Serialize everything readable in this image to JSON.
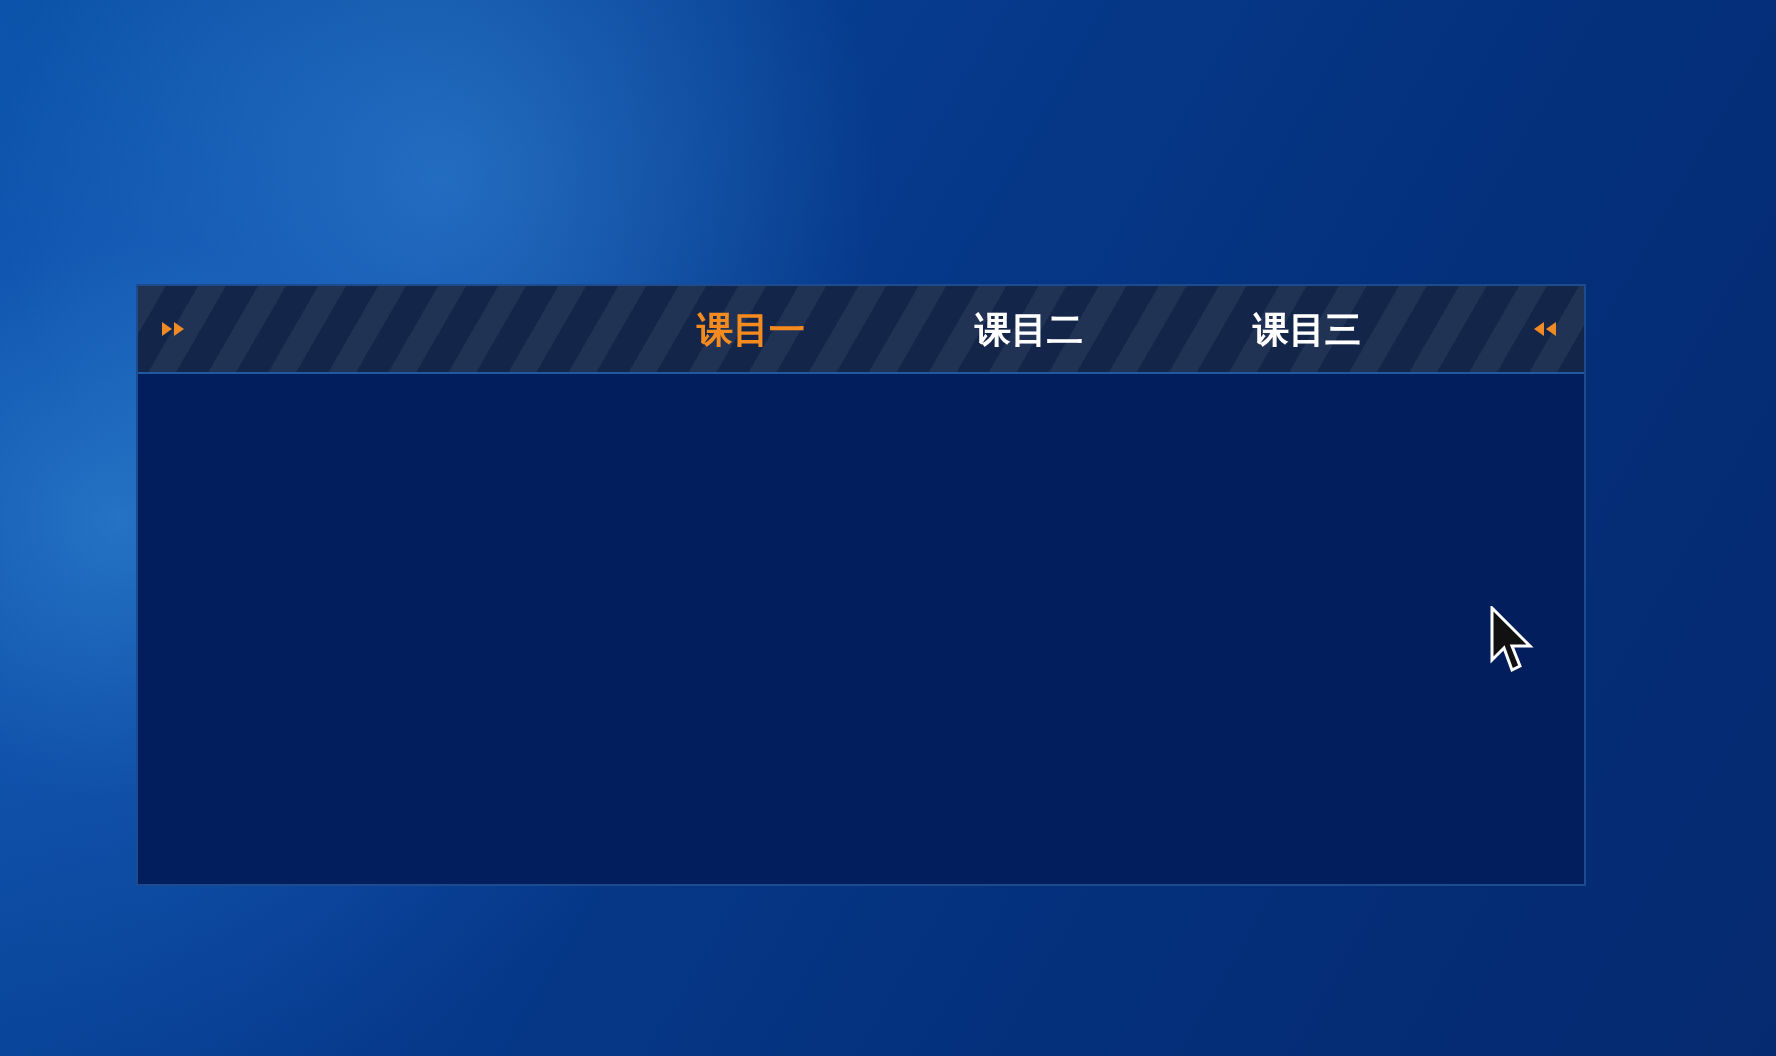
{
  "tabs": [
    {
      "label": "课目一",
      "selected": true
    },
    {
      "label": "课目二",
      "selected": false
    },
    {
      "label": "课目三",
      "selected": false
    }
  ]
}
